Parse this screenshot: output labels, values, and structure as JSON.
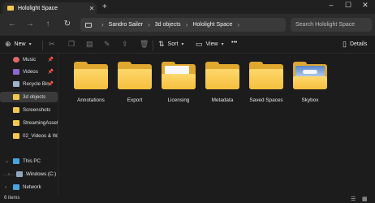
{
  "tab": {
    "title": "Hololight Space"
  },
  "address": {
    "crumbs": [
      "Sandro Sailer",
      "3d objects",
      "Hololight Space"
    ]
  },
  "search": {
    "placeholder": "Search Hololight Space"
  },
  "toolbar": {
    "new": "New",
    "sort": "Sort",
    "view": "View",
    "more": "•••",
    "details": "Details"
  },
  "sidebar": {
    "items": [
      {
        "label": "Music"
      },
      {
        "label": "Videos"
      },
      {
        "label": "Recycle Bin"
      },
      {
        "label": "3d objects"
      },
      {
        "label": "Screenshots"
      },
      {
        "label": "StreamingAssets"
      },
      {
        "label": "02_Videos & Wa"
      },
      {
        "label": "This PC"
      },
      {
        "label": "Windows (C:)"
      },
      {
        "label": "Network"
      }
    ]
  },
  "folders": [
    {
      "name": "Annotations"
    },
    {
      "name": "Export"
    },
    {
      "name": "Licensing"
    },
    {
      "name": "Metadata"
    },
    {
      "name": "Saved Spaces"
    },
    {
      "name": "Skybox"
    }
  ],
  "status": {
    "items": "6 items"
  },
  "colors": {
    "folder": "#f4bf3e",
    "background": "#1c1c1c"
  }
}
